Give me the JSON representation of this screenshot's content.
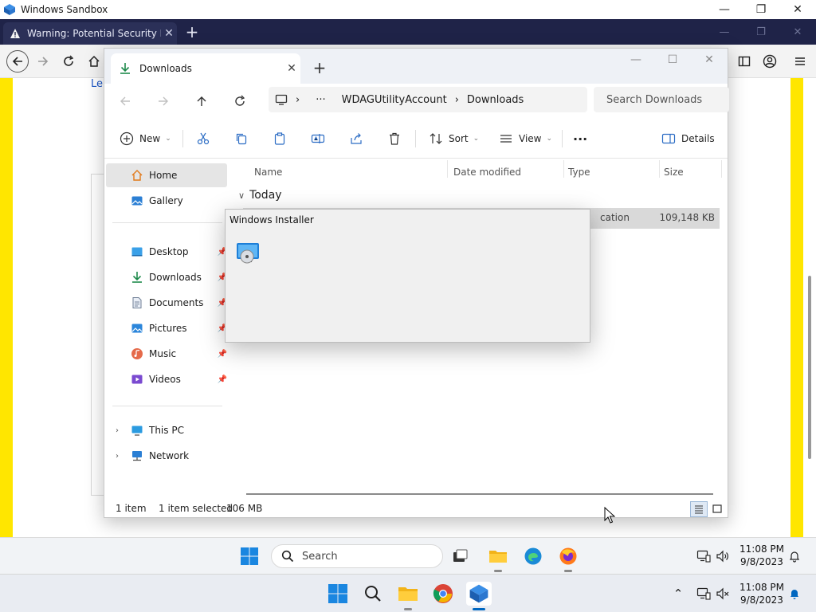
{
  "sandbox": {
    "title": "Windows Sandbox",
    "caption_min": "—",
    "caption_max": "❐",
    "caption_close": "✕"
  },
  "browser": {
    "tab_title": "Warning: Potential Security Ris",
    "tab_close": "✕",
    "new_tab": "+",
    "page_link_text": "Le"
  },
  "explorer": {
    "tab_title": "Downloads",
    "tab_close": "✕",
    "new_tab": "+",
    "address": {
      "more": "···",
      "seg1": "WDAGUtilityAccount",
      "seg2": "Downloads"
    },
    "search_placeholder": "Search Downloads",
    "commands": {
      "new": "New",
      "sort": "Sort",
      "view": "View",
      "more": "···",
      "details": "Details"
    },
    "nav": {
      "home": "Home",
      "gallery": "Gallery",
      "desktop": "Desktop",
      "downloads": "Downloads",
      "documents": "Documents",
      "pictures": "Pictures",
      "music": "Music",
      "videos": "Videos",
      "this_pc": "This PC",
      "network": "Network"
    },
    "columns": {
      "name": "Name",
      "date": "Date modified",
      "type": "Type",
      "size": "Size"
    },
    "group": "Today",
    "row": {
      "type_visible": "cation",
      "size": "109,148 KB"
    },
    "status": {
      "count": "1 item",
      "selected": "1 item selected",
      "size": "106 MB"
    }
  },
  "installer": {
    "title": "Windows Installer"
  },
  "taskbar_inner": {
    "search": "Search",
    "time": "11:08 PM",
    "date": "9/8/2023"
  },
  "taskbar_outer": {
    "time": "11:08 PM",
    "date": "9/8/2023",
    "chevron": "⌃"
  },
  "colors": {
    "tabstrip": "#1f2348",
    "yellow": "#ffe600",
    "accent_blue": "#0067c0"
  }
}
